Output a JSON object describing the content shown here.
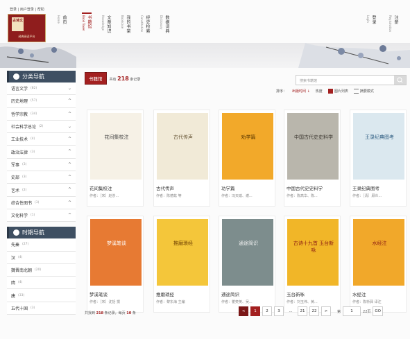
{
  "top_links": "登录 | 用户登录 | 帮助",
  "logo": {
    "seal": "古诗文",
    "subtitle": "经典阅读平台"
  },
  "nav": [
    {
      "en": "Home",
      "cn": "首页"
    },
    {
      "en": "Book Tower",
      "cn": "书籍馆"
    },
    {
      "en": "Knowledge",
      "cn": "文章知识"
    },
    {
      "en": "Bookcase",
      "cn": "我的书架"
    },
    {
      "en": "Constitution",
      "cn": "经史检索"
    },
    {
      "en": "Dictionary",
      "cn": "数据词典"
    }
  ],
  "nav_right": [
    {
      "en": "Login",
      "cn": "登录"
    },
    {
      "en": "Registration",
      "cn": "注册"
    }
  ],
  "sidebar": {
    "category_title": "分类导航",
    "categories": [
      {
        "label": "语言文学",
        "count": "(82)"
      },
      {
        "label": "历史地理",
        "count": "(57)"
      },
      {
        "label": "哲学宗教",
        "count": "(34)"
      },
      {
        "label": "社会科学总论",
        "count": "(2)"
      },
      {
        "label": "工业技术",
        "count": "(4)"
      },
      {
        "label": "政治法律",
        "count": "(3)"
      },
      {
        "label": "军事",
        "count": "(3)"
      },
      {
        "label": "史部",
        "count": "(3)"
      },
      {
        "label": "艺术",
        "count": "(2)"
      },
      {
        "label": "综合性图书",
        "count": "(3)"
      },
      {
        "label": "文化科学",
        "count": "(1)"
      }
    ],
    "era_title": "时期导航",
    "eras": [
      {
        "label": "先秦",
        "count": "(27)"
      },
      {
        "label": "汉",
        "count": "(4)"
      },
      {
        "label": "魏晋南北朝",
        "count": "(20)"
      },
      {
        "label": "隋",
        "count": "(4)"
      },
      {
        "label": "唐",
        "count": "(33)"
      },
      {
        "label": "五代十国",
        "count": "(3)"
      }
    ]
  },
  "list": {
    "badge": "书籍馆",
    "count_prefix": "共有",
    "count": "218",
    "count_suffix": "条记录"
  },
  "search": {
    "placeholder": "搜索书籍馆"
  },
  "sort": {
    "label": "排序：",
    "by_time": "出版时间 ↓",
    "by_hot": "热度",
    "view_grid": "图片列表",
    "view_list": "摘要模式"
  },
  "books": [
    {
      "title": "花间集校注",
      "author": "作者：［宋］赵崇...",
      "cover_text": "花间集校注",
      "cover_color": "#f6f1e6",
      "text_color": "#444"
    },
    {
      "title": "古代传声",
      "author": "作者：陈德兹 等",
      "cover_text": "古代传声",
      "cover_color": "#f1ead7",
      "text_color": "#6b5a3b"
    },
    {
      "title": "功学篇",
      "author": "作者：冯天瑜、谢...",
      "cover_text": "劝学篇",
      "cover_color": "#f2a92a",
      "text_color": "#5a3700"
    },
    {
      "title": "中国古代史史料学",
      "author": "作者：陈高华、陈...",
      "cover_text": "中国古代史史料学",
      "cover_color": "#b9b6ac",
      "text_color": "#3e3a33"
    },
    {
      "title": "王录纪典图考",
      "author": "作者：［清］顾炎...",
      "cover_text": "王录纪典图考",
      "cover_color": "#dbe8ef",
      "text_color": "#2c5b80"
    },
    {
      "title": "梦溪笔谈",
      "author": "作者：［宋］沈括 撰",
      "cover_text": "梦溪笔谈",
      "cover_color": "#e77a33",
      "text_color": "#fff"
    },
    {
      "title": "推磨琐经",
      "author": "作者：黎东海 主编",
      "cover_text": "推磨琐经",
      "cover_color": "#f4c63a",
      "text_color": "#6b3d00"
    },
    {
      "title": "通途简识",
      "author": "作者：瞿奕英、吴...",
      "cover_text": "通途简识",
      "cover_color": "#7d8d8d",
      "text_color": "#f2f2f2"
    },
    {
      "title": "玉台新咏",
      "author": "作者：刘玉伟、黄...",
      "cover_text": "古诗十九首 玉台新咏",
      "cover_color": "#f1b628",
      "text_color": "#8b1b12"
    },
    {
      "title": "水经注",
      "author": "作者：陈桥驿 译注",
      "cover_text": "水经注",
      "cover_color": "#f1a82a",
      "text_color": "#8b1b12"
    }
  ],
  "pager_info": {
    "prefix": "共找到",
    "total": "218",
    "mid": "条记录，每页",
    "per_page": "10",
    "suffix": "条"
  },
  "pager": {
    "prev": "<",
    "pages": [
      "1",
      "2",
      "3",
      "...",
      "21",
      "22"
    ],
    "next": ">",
    "jump_prefix": "第",
    "jump_value": "1",
    "jump_suffix": "22页",
    "go": "GO"
  }
}
